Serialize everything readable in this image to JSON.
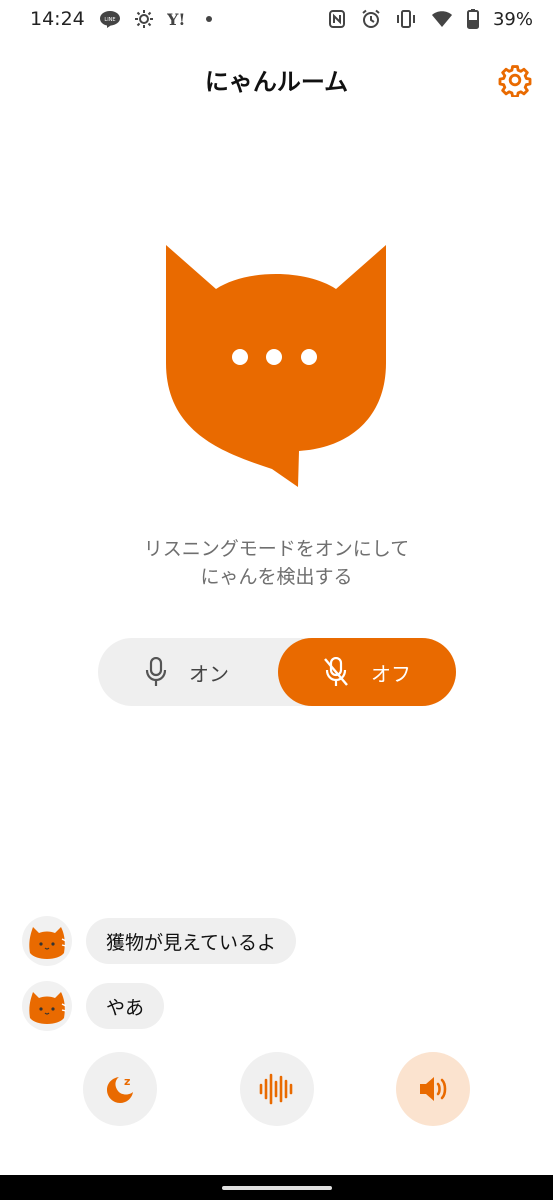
{
  "status_bar": {
    "time": "14:24",
    "battery": "39%",
    "left_icons": [
      "line-icon",
      "weather-icon",
      "yahoo-icon",
      "dot-icon"
    ],
    "right_icons": [
      "nfc-icon",
      "alarm-icon",
      "vibrate-icon",
      "wifi-icon",
      "battery-icon"
    ]
  },
  "header": {
    "title": "にゃんルーム",
    "settings_icon": "gear-icon"
  },
  "colors": {
    "accent": "#e96a00",
    "pill_bg": "#efefef",
    "active_button_bg": "#fbe3cf",
    "hint_text": "#6f6f6f"
  },
  "hint": {
    "line1": "リスニングモードをオンにして",
    "line2": "にゃんを検出する"
  },
  "listening_toggle": {
    "on_label": "オン",
    "off_label": "オフ",
    "selected": "off",
    "on_icon": "microphone-icon",
    "off_icon": "microphone-off-icon"
  },
  "messages": [
    {
      "text": "獲物が見えているよ",
      "avatar": "cat-avatar-icon"
    },
    {
      "text": "やあ",
      "avatar": "cat-avatar-icon"
    }
  ],
  "actions": [
    {
      "icon": "sleep-moon-icon",
      "active": false
    },
    {
      "icon": "sound-wave-icon",
      "active": false
    },
    {
      "icon": "speaker-icon",
      "active": true
    }
  ]
}
